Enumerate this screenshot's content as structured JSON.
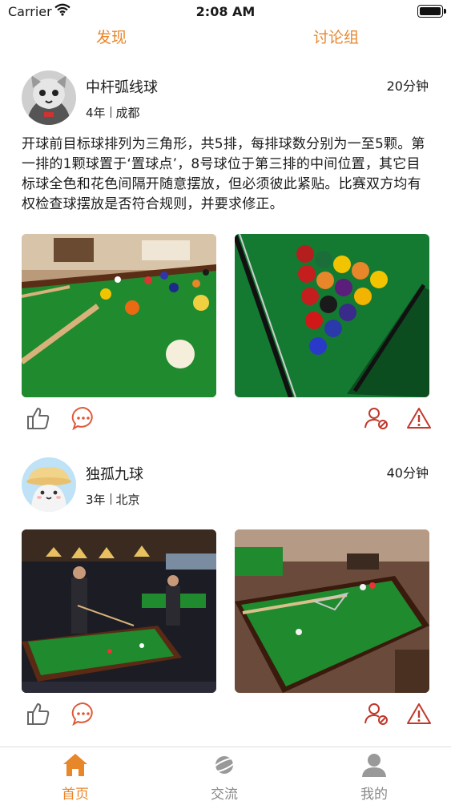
{
  "status_bar": {
    "carrier": "Carrier",
    "time": "2:08 AM"
  },
  "top_tabs": {
    "discover": "发现",
    "discuss": "讨论组"
  },
  "posts": [
    {
      "username": "中杆弧线球",
      "years": "4年",
      "city": "成都",
      "time_ago": "20分钟",
      "text": "开球前目标球排列为三角形，共5排，每排球数分别为一至5颗。第一排的1颗球置于‘置球点’，8号球位于第三排的中间位置，其它目标球全色和花色间隔开随意摆放，但必须彼此紧贴。比赛双方均有权检查球摆放是否符合规则，并要求修正。"
    },
    {
      "username": "独孤九球",
      "years": "3年",
      "city": "北京",
      "time_ago": "40分钟",
      "text": ""
    }
  ],
  "tab_bar": {
    "home": "首页",
    "chat": "交流",
    "me": "我的"
  },
  "colors": {
    "accent": "#e8862a",
    "report": "#c0392b",
    "table_green": "#1f8a2e"
  }
}
